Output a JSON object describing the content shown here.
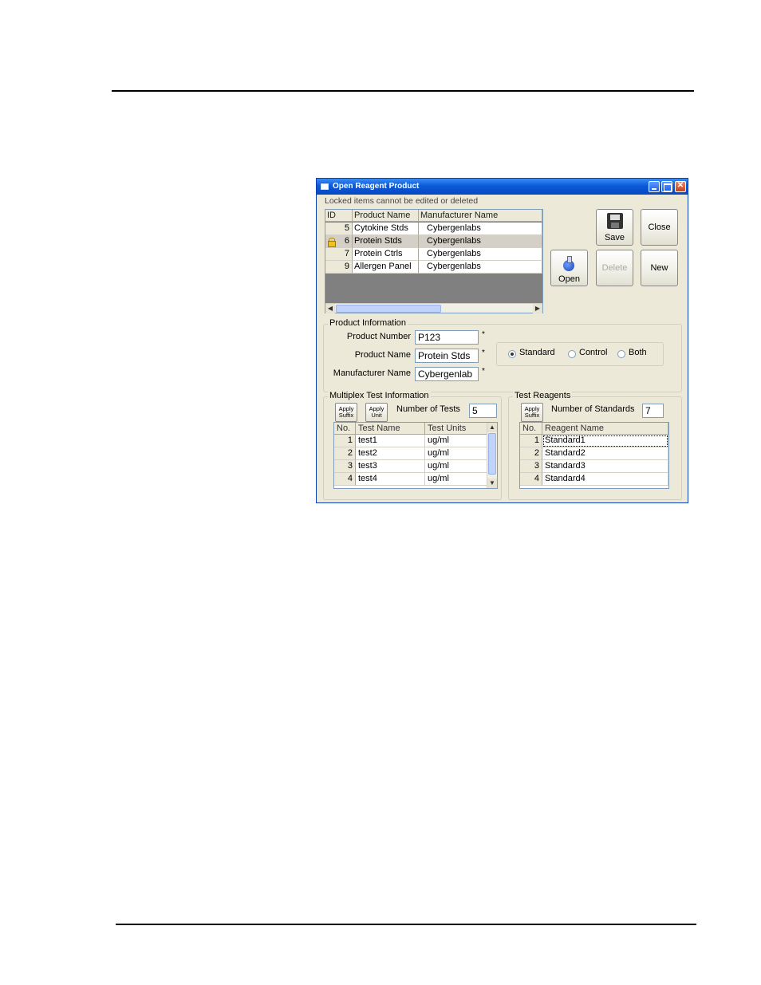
{
  "window": {
    "title": "Open Reagent Product",
    "note": "Locked items cannot be edited or deleted"
  },
  "products": {
    "columns": [
      "ID",
      "Product Name",
      "Manufacturer Name"
    ],
    "rows": [
      {
        "id": "5",
        "name": "Cytokine Stds",
        "manufacturer": "Cybergenlabs"
      },
      {
        "id": "6",
        "name": "Protein Stds",
        "manufacturer": "Cybergenlabs"
      },
      {
        "id": "7",
        "name": "Protein Ctrls",
        "manufacturer": "Cybergenlabs"
      },
      {
        "id": "9",
        "name": "Allergen Panel",
        "manufacturer": "Cybergenlabs"
      }
    ]
  },
  "buttons": {
    "save": "Save",
    "close": "Close",
    "open": "Open",
    "delete": "Delete",
    "new": "New"
  },
  "product_info": {
    "legend": "Product Information",
    "product_number_label": "Product Number",
    "product_number": "P123",
    "product_name_label": "Product Name",
    "product_name": "Protein Stds",
    "manufacturer_label": "Manufacturer Name",
    "manufacturer": "Cybergenlab",
    "required_mark": "*",
    "type_options": [
      "Standard",
      "Control",
      "Both"
    ],
    "type_selected": "Standard"
  },
  "multiplex": {
    "legend": "Multiplex Test Information",
    "apply_suffix": "Apply Suffix",
    "apply_unit": "Apply Unit",
    "num_tests_label": "Number of Tests",
    "num_tests": "5",
    "columns": [
      "No.",
      "Test Name",
      "Test Units"
    ],
    "rows": [
      {
        "no": "1",
        "name": "test1",
        "units": "ug/ml"
      },
      {
        "no": "2",
        "name": "test2",
        "units": "ug/ml"
      },
      {
        "no": "3",
        "name": "test3",
        "units": "ug/ml"
      },
      {
        "no": "4",
        "name": "test4",
        "units": "ug/ml"
      }
    ]
  },
  "reagents": {
    "legend": "Test Reagents",
    "apply_suffix": "Apply Suffix",
    "num_standards_label": "Number of Standards",
    "num_standards": "7",
    "columns": [
      "No.",
      "Reagent Name"
    ],
    "rows": [
      {
        "no": "1",
        "name": "Standard1"
      },
      {
        "no": "2",
        "name": "Standard2"
      },
      {
        "no": "3",
        "name": "Standard3"
      },
      {
        "no": "4",
        "name": "Standard4"
      }
    ]
  }
}
